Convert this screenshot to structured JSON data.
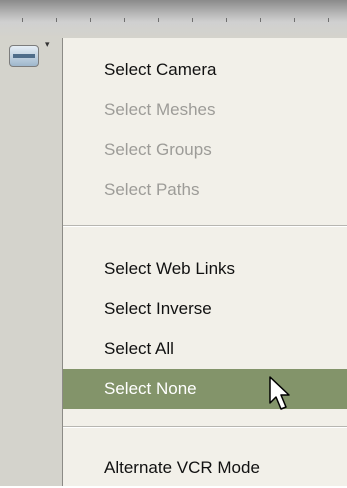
{
  "menu": {
    "groups": [
      {
        "items": [
          {
            "label": "Select Camera",
            "enabled": true
          },
          {
            "label": "Select Meshes",
            "enabled": false
          },
          {
            "label": "Select Groups",
            "enabled": false
          },
          {
            "label": "Select Paths",
            "enabled": false
          }
        ]
      },
      {
        "items": [
          {
            "label": "Select Web Links",
            "enabled": true
          },
          {
            "label": "Select Inverse",
            "enabled": true
          },
          {
            "label": "Select All",
            "enabled": true
          },
          {
            "label": "Select None",
            "enabled": true,
            "highlighted": true
          }
        ]
      },
      {
        "items": [
          {
            "label": "Alternate VCR Mode",
            "enabled": true
          }
        ]
      }
    ]
  },
  "toolbar": {
    "button_icon": "select-tool-icon",
    "indicator_icon": "dropdown-arrow-icon"
  },
  "cursor": {
    "icon": "arrow-pointer-icon"
  },
  "colors": {
    "menu_background": "#f2f0e9",
    "highlight": "#83946a",
    "disabled_text": "#9d9c98"
  }
}
